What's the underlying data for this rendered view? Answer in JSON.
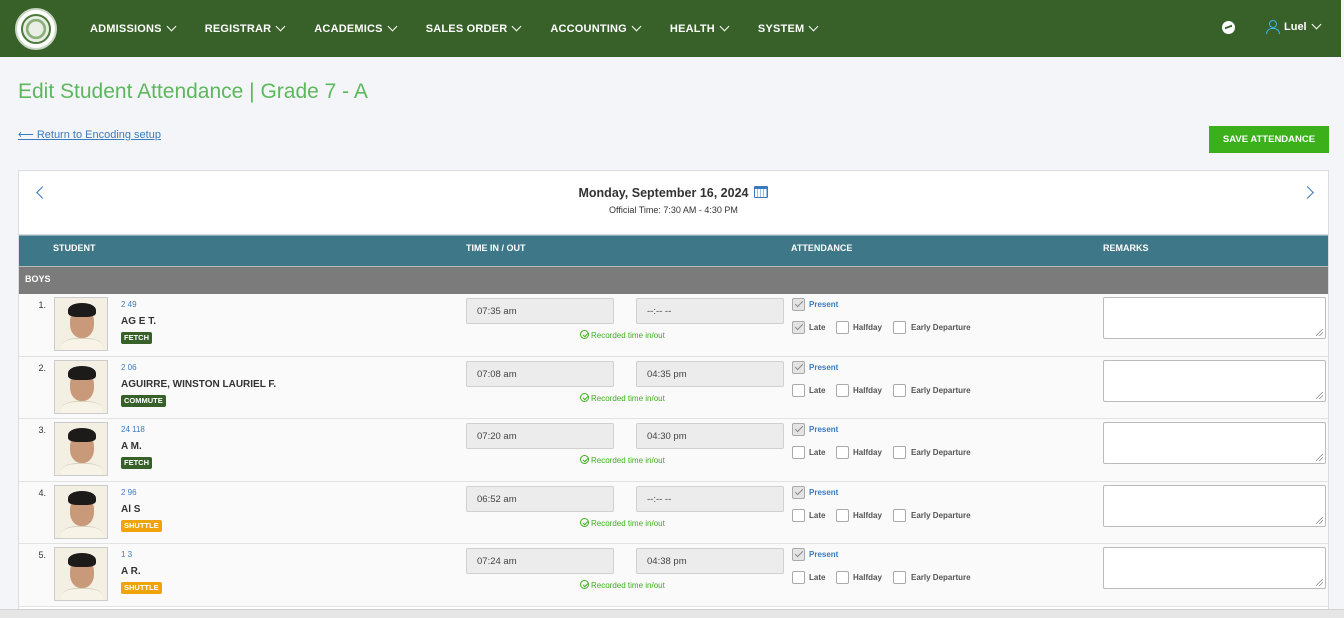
{
  "nav": {
    "items": [
      {
        "label": "ADMISSIONS"
      },
      {
        "label": "REGISTRAR"
      },
      {
        "label": "ACADEMICS"
      },
      {
        "label": "SALES ORDER"
      },
      {
        "label": "ACCOUNTING"
      },
      {
        "label": "HEALTH"
      },
      {
        "label": "SYSTEM"
      }
    ],
    "user": "Luel"
  },
  "page": {
    "title": "Edit Student Attendance | Grade 7 - A",
    "back_link": "⟵ Return to Encoding setup",
    "save_label": "SAVE ATTENDANCE"
  },
  "date_bar": {
    "date": "Monday, September 16, 2024",
    "official_time": "Official Time: 7:30 AM - 4:30 PM"
  },
  "table": {
    "headers": {
      "student": "STUDENT",
      "time": "TIME IN / OUT",
      "attendance": "ATTENDANCE",
      "remarks": "REMARKS"
    },
    "group": "BOYS",
    "recorded_text": "Recorded time in/out",
    "labels": {
      "present": "Present",
      "late": "Late",
      "halfday": "Halfday",
      "early": "Early Departure"
    },
    "rows": [
      {
        "num": "1.",
        "id": "2    49",
        "name": "AG                                    E T.",
        "badge": "FETCH",
        "time_in": "07:35 am",
        "time_out": "--:-- --",
        "present": true,
        "late": true,
        "halfday": false,
        "early": false
      },
      {
        "num": "2.",
        "id": "2    06",
        "name": "AGUIRRE, WINSTON LAURIEL F.",
        "badge": "COMMUTE",
        "time_in": "07:08 am",
        "time_out": "04:35 pm",
        "present": true,
        "late": false,
        "halfday": false,
        "early": false
      },
      {
        "num": "3.",
        "id": "24  118",
        "name": "A                             M.",
        "badge": "FETCH",
        "time_in": "07:20 am",
        "time_out": "04:30 pm",
        "present": true,
        "late": false,
        "halfday": false,
        "early": false
      },
      {
        "num": "4.",
        "id": "2    96",
        "name": "Al                          S",
        "badge": "SHUTTLE",
        "time_in": "06:52 am",
        "time_out": "--:-- --",
        "present": true,
        "late": false,
        "halfday": false,
        "early": false
      },
      {
        "num": "5.",
        "id": "1    3",
        "name": "A                             R.",
        "badge": "SHUTTLE",
        "time_in": "07:24 am",
        "time_out": "04:38 pm",
        "present": true,
        "late": false,
        "halfday": false,
        "early": false
      }
    ]
  },
  "colors": {
    "nav_bg": "#376129",
    "table_header": "#3e7787",
    "fetch": "#376129",
    "commute": "#376129",
    "shuttle": "#f0a30a",
    "save_button": "#3bb01b"
  }
}
